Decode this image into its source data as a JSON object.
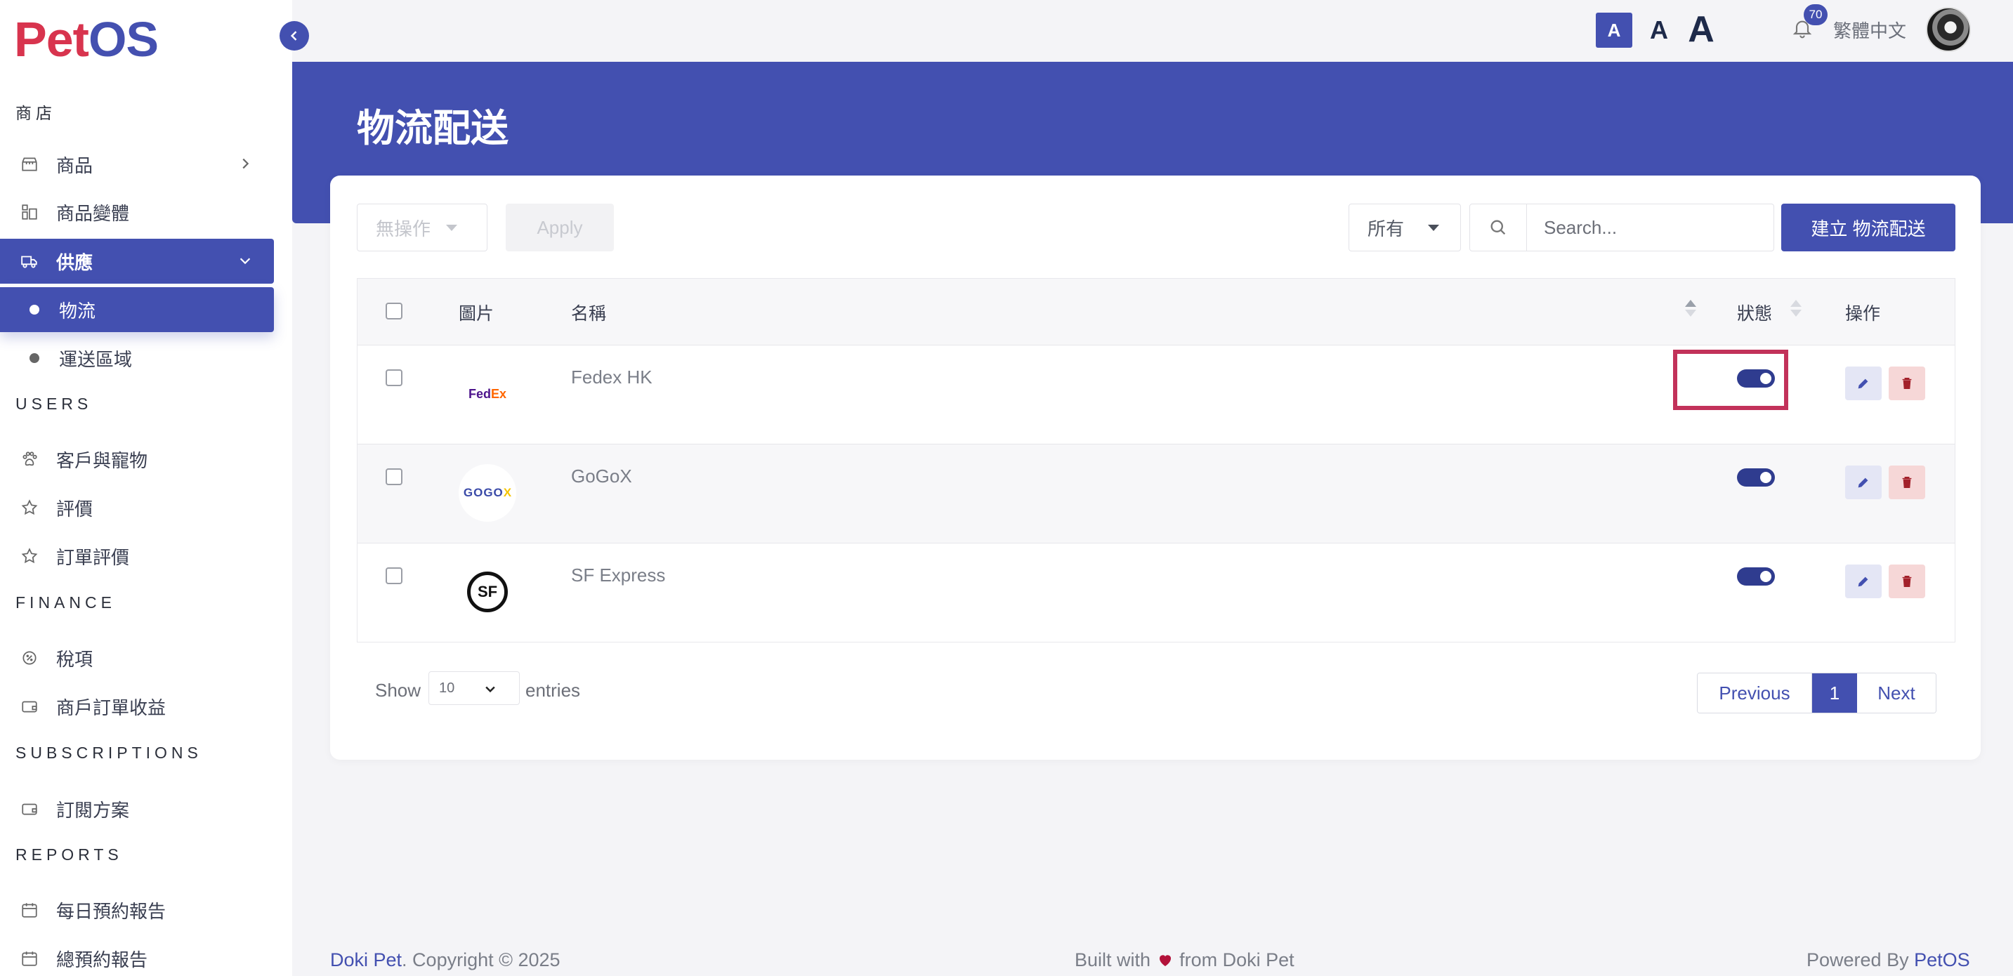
{
  "app": {
    "logo_part1": "Pet",
    "logo_part2": "OS",
    "brand_color": "#4350b0",
    "logo_red": "#d8344e"
  },
  "sidebar": {
    "sections": {
      "shop": "商店",
      "users": "USERS",
      "finance": "FINANCE",
      "subscriptions": "SUBSCRIPTIONS",
      "reports": "REPORTS"
    },
    "items": {
      "products": "商品",
      "variants": "商品變體",
      "supply": "供應",
      "logistics": "物流",
      "delivery_zones": "運送區域",
      "customers_pets": "客戶與寵物",
      "reviews": "評價",
      "order_reviews": "訂單評價",
      "tax": "稅項",
      "merchant_revenue": "商戶訂單收益",
      "plans": "訂閱方案",
      "daily_report": "每日預約報告",
      "total_report": "總預約報告"
    }
  },
  "topbar": {
    "font_small": "A",
    "font_medium": "A",
    "font_large": "A",
    "notification_count": "70",
    "language": "繁體中文"
  },
  "page": {
    "title": "物流配送"
  },
  "toolbar": {
    "bulk_action": "無操作",
    "apply": "Apply",
    "filter": "所有",
    "search_placeholder": "Search...",
    "create": "建立 物流配送"
  },
  "table": {
    "headers": {
      "image": "圖片",
      "name": "名稱",
      "status": "狀態",
      "actions": "操作"
    },
    "rows": [
      {
        "name": "Fedex HK",
        "logo_text_a": "Fed",
        "logo_text_b": "Ex",
        "status": true
      },
      {
        "name": "GoGoX",
        "logo_text_a": "GOGO",
        "logo_text_b": "X",
        "status": true
      },
      {
        "name": "SF Express",
        "logo_text_a": "SF",
        "logo_text_b": "",
        "status": true
      }
    ]
  },
  "pagination": {
    "show": "Show",
    "page_length": "10",
    "entries": "entries",
    "previous": "Previous",
    "current": "1",
    "next": "Next"
  },
  "footer": {
    "brand": "Doki Pet",
    "copyright": ". Copyright © 2025",
    "built_prefix": "Built with",
    "built_suffix": "from Doki Pet",
    "powered_prefix": "Powered By",
    "powered_brand": "PetOS"
  }
}
